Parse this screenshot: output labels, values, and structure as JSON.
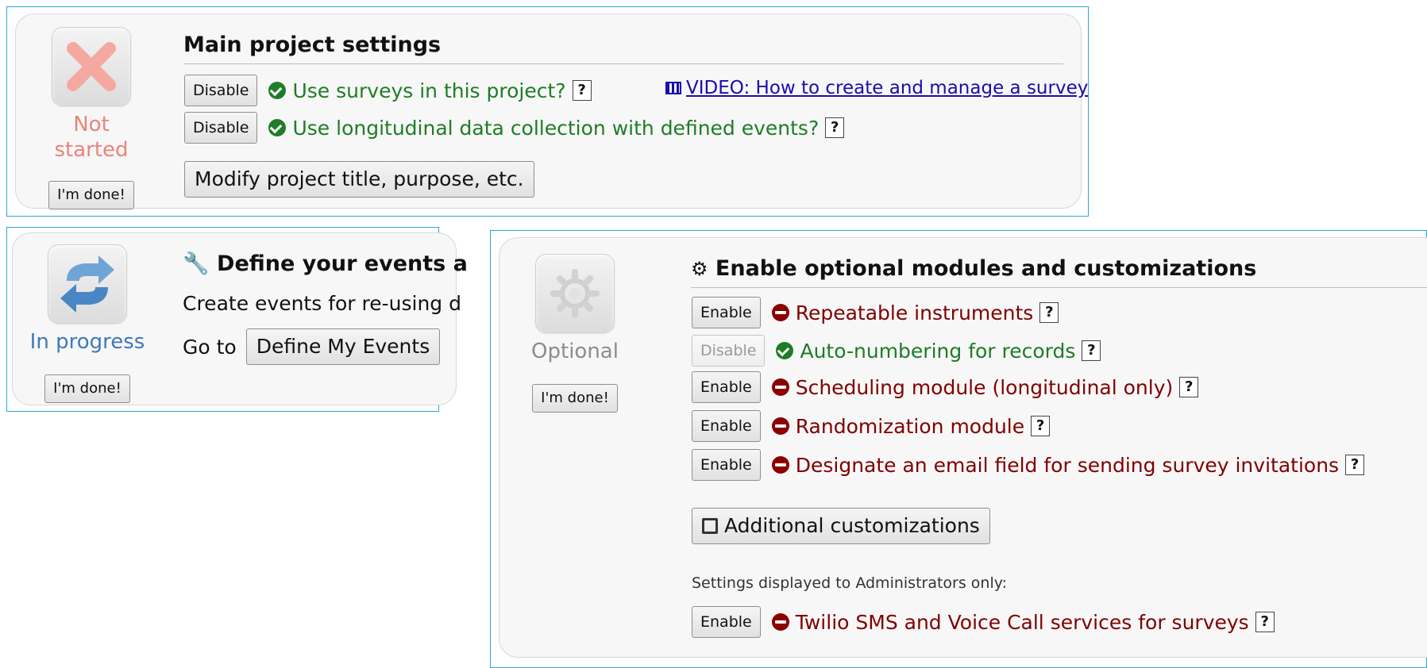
{
  "main_settings": {
    "status": {
      "icon": "x-mark-icon",
      "label_line1": "Not",
      "label_line2": "started",
      "done_label": "I'm done!",
      "color": "#e8857a"
    },
    "title": "Main project settings",
    "rows": [
      {
        "button": "Disable",
        "icon": "check-circle-icon",
        "label": "Use surveys in this project?",
        "help": "?"
      },
      {
        "button": "Disable",
        "icon": "check-circle-icon",
        "label": "Use longitudinal data collection with defined events?",
        "help": "?"
      }
    ],
    "video": {
      "icon": "film-icon",
      "label": "VIDEO: How to create and manage a survey"
    },
    "modify_button": "Modify project title, purpose, etc."
  },
  "define_events": {
    "status": {
      "icon": "refresh-arrows-icon",
      "label": "In progress",
      "done_label": "I'm done!",
      "color": "#3d7ab8"
    },
    "title_icon": "wrench-icon",
    "title": "Define your events a",
    "desc": "Create events for re-using d",
    "goto_label": "Go to",
    "button": "Define My Events"
  },
  "optional_modules": {
    "status": {
      "icon": "gear-icon",
      "label": "Optional",
      "done_label": "I'm done!",
      "color": "#8c8c8c"
    },
    "title_icon": "cogs-icon",
    "title": "Enable optional modules and customizations",
    "rows": [
      {
        "button": "Enable",
        "state": "off",
        "label": "Repeatable instruments",
        "help": "?"
      },
      {
        "button": "Disable",
        "state": "on",
        "label": "Auto-numbering for records",
        "help": "?"
      },
      {
        "button": "Enable",
        "state": "off",
        "label": "Scheduling module (longitudinal only)",
        "help": "?"
      },
      {
        "button": "Enable",
        "state": "off",
        "label": "Randomization module",
        "help": "?"
      },
      {
        "button": "Enable",
        "state": "off",
        "label": "Designate an email field for sending survey invitations",
        "help": "?"
      }
    ],
    "custom_button": "Additional customizations",
    "admin_note": "Settings displayed to Administrators only:",
    "admin_row": {
      "button": "Enable",
      "state": "off",
      "label": "Twilio SMS and Voice Call services for surveys",
      "help": "?"
    }
  },
  "colors": {
    "frame": "#29a8d8",
    "on": "#1e7d26",
    "off": "#800000",
    "link": "#1a0dab"
  }
}
